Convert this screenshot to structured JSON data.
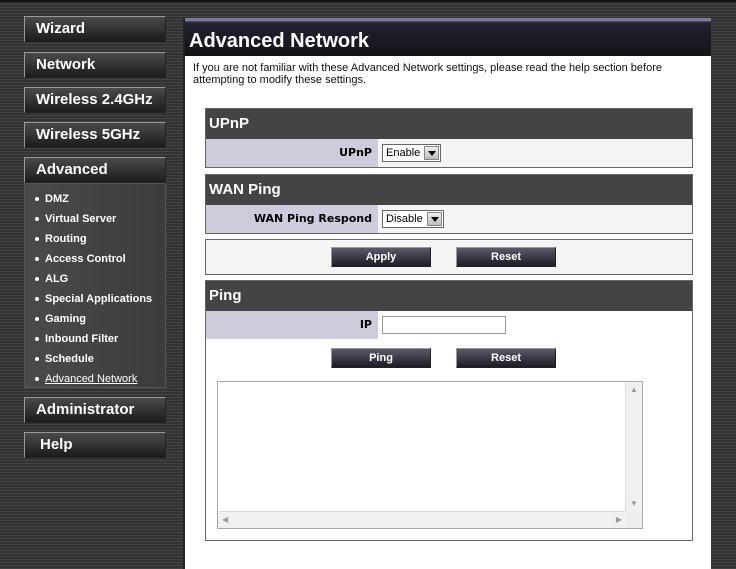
{
  "nav": {
    "wizard": "Wizard",
    "network": "Network",
    "wireless24": "Wireless 2.4GHz",
    "wireless5": "Wireless 5GHz",
    "advanced": "Advanced",
    "administrator": "Administrator",
    "help": "Help",
    "advanced_items": [
      "DMZ",
      "Virtual Server",
      "Routing",
      "Access Control",
      "ALG",
      "Special Applications",
      "Gaming",
      "Inbound Filter",
      "Schedule",
      "Advanced Network"
    ],
    "active_item": "Advanced Network"
  },
  "main": {
    "title": "Advanced Network",
    "intro": "If you are not familiar with these Advanced Network settings, please read the help section before attempting to modify these settings."
  },
  "upnp": {
    "heading": "UPnP",
    "label": "UPnP",
    "value": "Enable"
  },
  "wan_ping": {
    "heading": "WAN Ping",
    "label": "WAN Ping Respond",
    "value": "Disable"
  },
  "actions": {
    "apply": "Apply",
    "reset": "Reset"
  },
  "ping": {
    "heading": "Ping",
    "ip_label": "IP",
    "ip_value": "",
    "ping_button": "Ping",
    "reset_button": "Reset",
    "output": ""
  }
}
